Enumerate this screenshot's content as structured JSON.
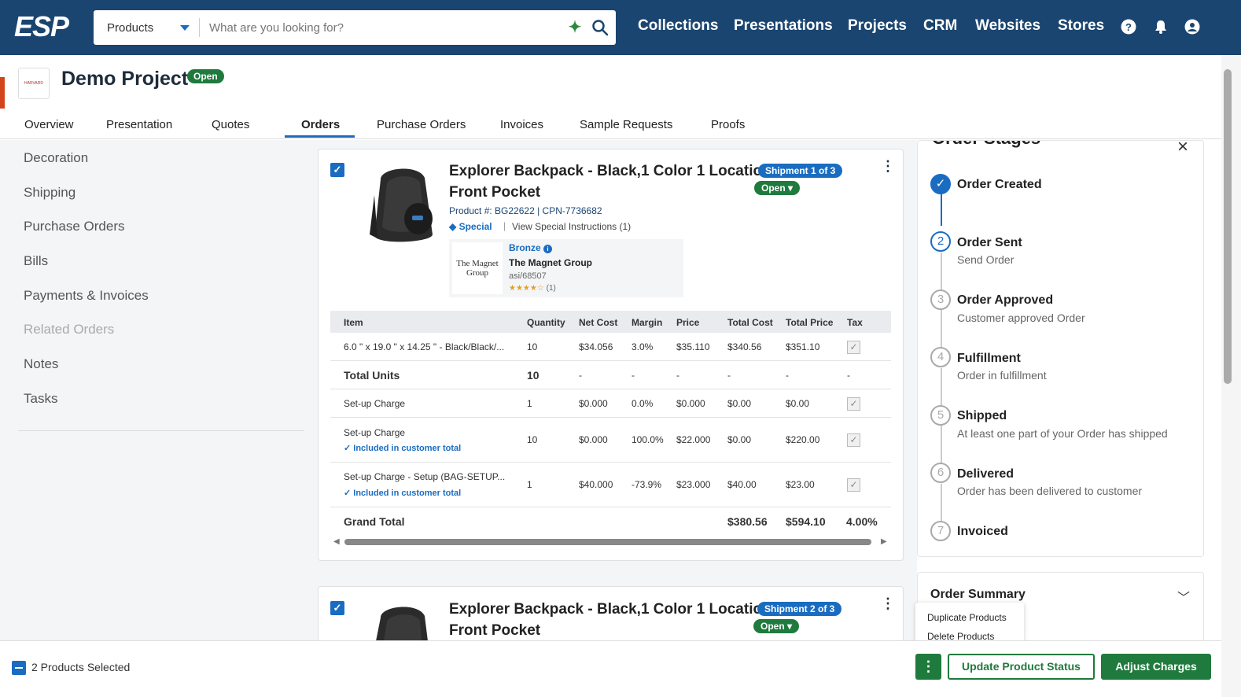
{
  "topbar": {
    "logo": "ESP",
    "search": {
      "category": "Products",
      "placeholder": "What are you looking for?"
    },
    "nav": [
      "Collections",
      "Presentations",
      "Projects",
      "CRM",
      "Websites",
      "Stores"
    ]
  },
  "project": {
    "title": "Demo Project",
    "status": "Open",
    "logo_text": "HARVARD"
  },
  "tabs": [
    "Overview",
    "Presentation",
    "Quotes",
    "Orders",
    "Purchase Orders",
    "Invoices",
    "Sample Requests",
    "Proofs"
  ],
  "active_tab": "Orders",
  "sidebar": [
    "Decoration",
    "Shipping",
    "Purchase Orders",
    "Bills",
    "Payments & Invoices",
    "Related Orders",
    "Notes",
    "Tasks"
  ],
  "product1": {
    "title_line1": "Explorer Backpack - Black,1 Color 1 Location",
    "title_line2": "Front Pocket",
    "shipment": "Shipment 1 of 3",
    "status": "Open",
    "product_num": "Product #: BG22622 | CPN-7736682",
    "special": "Special",
    "view_special": "View Special Instructions (1)",
    "supplier": {
      "tier": "Bronze",
      "name": "The Magnet Group",
      "asi": "asi/68507",
      "rating_count": "(1)",
      "logo_text": "The Magnet Group"
    },
    "table": {
      "headers": [
        "Item",
        "Quantity",
        "Net Cost",
        "Margin",
        "Price",
        "Total Cost",
        "Total Price",
        "Tax"
      ],
      "rows": [
        {
          "item": "6.0 \" x 19.0 \" x 14.25 \" - Black/Black/...",
          "qty": "10",
          "net": "$34.056",
          "margin": "3.0%",
          "price": "$35.110",
          "tcost": "$340.56",
          "tprice": "$351.10"
        },
        {
          "item": "Total Units",
          "qty": "10",
          "net": "-",
          "margin": "-",
          "price": "-",
          "tcost": "-",
          "tprice": "-",
          "tax": "-"
        },
        {
          "item": "Set-up Charge",
          "qty": "1",
          "net": "$0.000",
          "margin": "0.0%",
          "price": "$0.000",
          "tcost": "$0.00",
          "tprice": "$0.00"
        },
        {
          "item": "Set-up Charge",
          "note": "Included in customer total",
          "qty": "10",
          "net": "$0.000",
          "margin": "100.0%",
          "price": "$22.000",
          "tcost": "$0.00",
          "tprice": "$220.00"
        },
        {
          "item": "Set-up Charge - Setup (BAG-SETUP...",
          "note": "Included in customer total",
          "qty": "1",
          "net": "$40.000",
          "margin": "-73.9%",
          "price": "$23.000",
          "tcost": "$40.00",
          "tprice": "$23.00"
        }
      ],
      "grand_total": {
        "label": "Grand Total",
        "tcost": "$380.56",
        "tprice": "$594.10",
        "tax": "4.00%"
      }
    }
  },
  "product2": {
    "title_line1": "Explorer Backpack - Black,1 Color 1 Location",
    "title_line2": "Front Pocket",
    "shipment": "Shipment 2 of 3",
    "status": "Open"
  },
  "stages": {
    "title": "Order Stages",
    "items": [
      {
        "num": "✓",
        "name": "Order Created",
        "desc": ""
      },
      {
        "num": "2",
        "name": "Order Sent",
        "desc": "Send Order"
      },
      {
        "num": "3",
        "name": "Order Approved",
        "desc": "Customer approved Order"
      },
      {
        "num": "4",
        "name": "Fulfillment",
        "desc": "Order in fulfillment"
      },
      {
        "num": "5",
        "name": "Shipped",
        "desc": "At least one part of your Order has shipped"
      },
      {
        "num": "6",
        "name": "Delivered",
        "desc": "Order has been delivered to customer"
      },
      {
        "num": "7",
        "name": "Invoiced",
        "desc": ""
      }
    ]
  },
  "summary": {
    "title": "Order Summary"
  },
  "popmenu": [
    "Duplicate Products",
    "Delete Products"
  ],
  "bottom": {
    "selected": "2 Products Selected",
    "update_btn": "Update Product Status",
    "adjust_btn": "Adjust Charges"
  },
  "colors": {
    "nav_bg": "#1a4570",
    "accent": "#1a6cc0",
    "success": "#1f7a3d"
  }
}
